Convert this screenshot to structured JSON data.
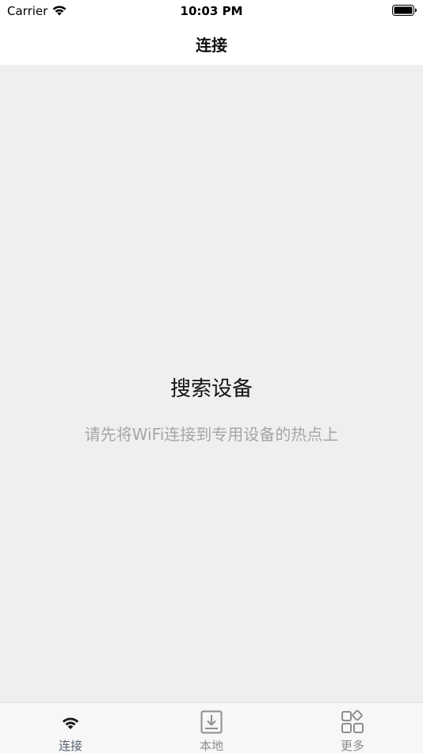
{
  "status_bar": {
    "carrier": "Carrier",
    "time": "10:03 PM",
    "icons": [
      "wifi-icon",
      "battery-icon"
    ]
  },
  "nav": {
    "title": "连接"
  },
  "main": {
    "empty_title": "搜索设备",
    "empty_subtitle": "请先将WiFi连接到专用设备的热点上"
  },
  "tab_bar": {
    "tabs": [
      {
        "label": "连接",
        "icon": "wifi-icon",
        "active": true
      },
      {
        "label": "本地",
        "icon": "download-box-icon",
        "active": false
      },
      {
        "label": "更多",
        "icon": "grid-more-icon",
        "active": false
      }
    ]
  },
  "colors": {
    "main_background": "#efefef",
    "active_tab": "#1c1c1e",
    "inactive_tab": "#8e8e8e",
    "subtitle": "#a6a6a6"
  }
}
